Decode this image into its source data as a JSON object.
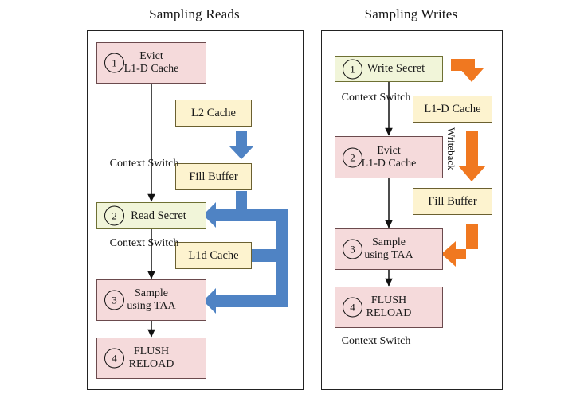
{
  "figure": {
    "colors": {
      "pink": "#f5dadb",
      "yellow": "#fdf3cf",
      "green": "#f1f5d9",
      "blue_arrow": "#4f83c4",
      "orange_arrow": "#f07820",
      "panel_border": "#222222",
      "text": "#141414"
    }
  },
  "panels": [
    {
      "id": "sampling-reads",
      "title": "Sampling Reads",
      "nodes": [
        {
          "id": "reads-evict",
          "badge": "1",
          "lines": [
            "Evict",
            "L1-D Cache"
          ],
          "fill": "pink"
        },
        {
          "id": "reads-l2",
          "badge": "",
          "lines": [
            "L2 Cache"
          ],
          "fill": "yellow"
        },
        {
          "id": "reads-fill",
          "badge": "",
          "lines": [
            "Fill Buffer"
          ],
          "fill": "yellow"
        },
        {
          "id": "reads-read",
          "badge": "2",
          "lines": [
            "Read Secret"
          ],
          "fill": "green"
        },
        {
          "id": "reads-l1d",
          "badge": "",
          "lines": [
            "L1d Cache"
          ],
          "fill": "yellow"
        },
        {
          "id": "reads-sample",
          "badge": "3",
          "lines": [
            "Sample",
            "using TAA"
          ],
          "fill": "pink"
        },
        {
          "id": "reads-flush",
          "badge": "4",
          "lines": [
            "FLUSH",
            "RELOAD"
          ],
          "fill": "pink"
        }
      ],
      "edge_labels": [
        {
          "id": "reads-ctx-1",
          "lines": [
            "Context",
            "Switch"
          ]
        },
        {
          "id": "reads-ctx-2",
          "lines": [
            "Context",
            "Switch"
          ]
        }
      ]
    },
    {
      "id": "sampling-writes",
      "title": "Sampling Writes",
      "nodes": [
        {
          "id": "writes-write",
          "badge": "1",
          "lines": [
            "Write Secret"
          ],
          "fill": "green"
        },
        {
          "id": "writes-l1d",
          "badge": "",
          "lines": [
            "L1-D Cache"
          ],
          "fill": "yellow"
        },
        {
          "id": "writes-evict",
          "badge": "2",
          "lines": [
            "Evict",
            "L1-D Cache"
          ],
          "fill": "pink"
        },
        {
          "id": "writes-fill",
          "badge": "",
          "lines": [
            "Fill Buffer"
          ],
          "fill": "yellow"
        },
        {
          "id": "writes-sample",
          "badge": "3",
          "lines": [
            "Sample",
            "using TAA"
          ],
          "fill": "pink"
        },
        {
          "id": "writes-flush",
          "badge": "4",
          "lines": [
            "FLUSH",
            "RELOAD"
          ],
          "fill": "pink"
        }
      ],
      "edge_labels": [
        {
          "id": "writes-ctx-1",
          "lines": [
            "Context",
            "Switch"
          ]
        },
        {
          "id": "writes-ctx-2",
          "lines": [
            "Context",
            "Switch"
          ]
        }
      ],
      "rotated_labels": [
        {
          "id": "writes-writeback",
          "text": "Writeback"
        }
      ]
    }
  ]
}
